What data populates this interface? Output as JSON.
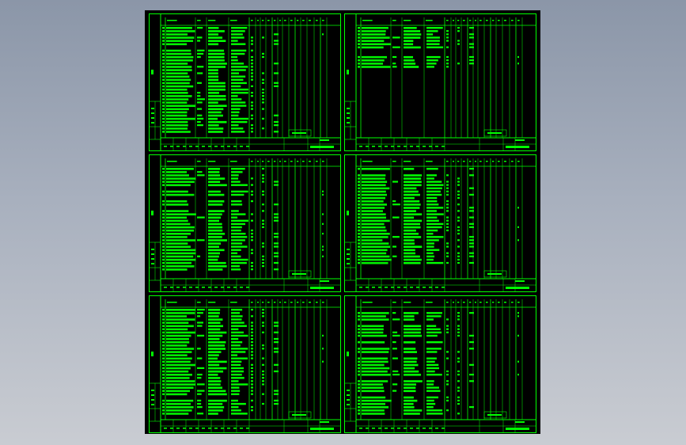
{
  "app": {
    "background": "#9aa3b2",
    "line_color": "#00ff00"
  },
  "drawing": {
    "sheets": [
      {
        "name": "sheet-1",
        "rows": 36
      },
      {
        "name": "sheet-2",
        "rows": 14
      },
      {
        "name": "sheet-3",
        "rows": 36
      },
      {
        "name": "sheet-4",
        "rows": 30
      },
      {
        "name": "sheet-5",
        "rows": 36
      },
      {
        "name": "sheet-6",
        "rows": 34
      }
    ]
  }
}
